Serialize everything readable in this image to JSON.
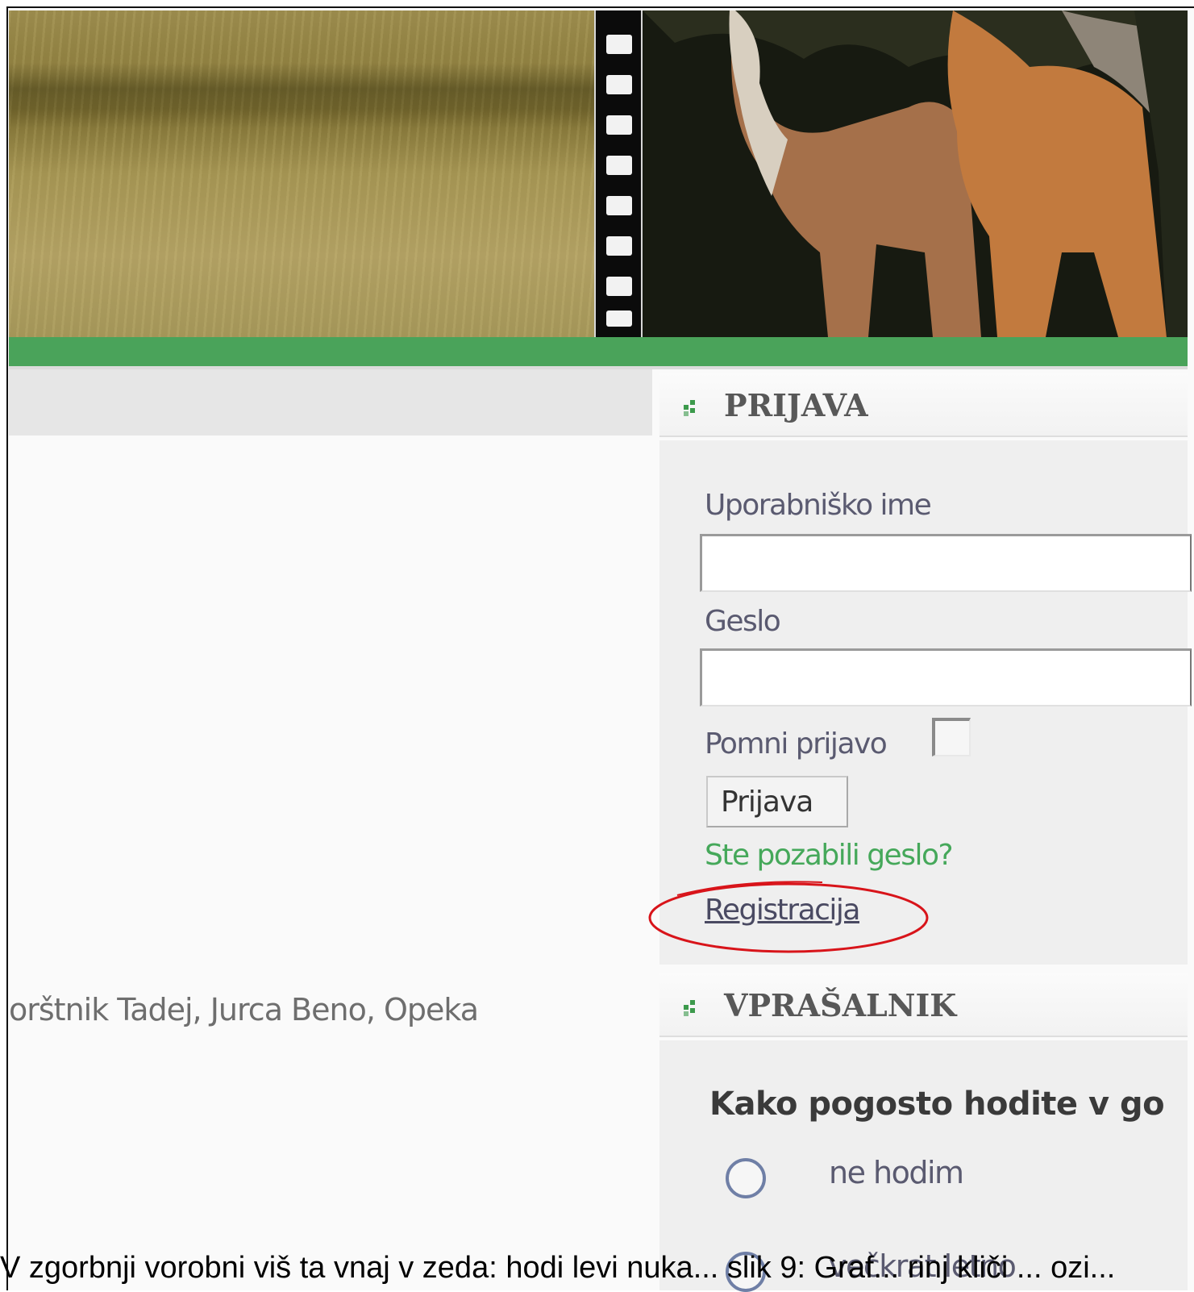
{
  "left": {
    "authors_text": "orštnik Tadej, Jurca Beno, Opeka"
  },
  "login": {
    "title": "PRIJAVA",
    "username_label": "Uporabniško ime",
    "username_value": "",
    "password_label": "Geslo",
    "password_value": "",
    "remember_label": "Pomni prijavo",
    "remember_checked": false,
    "submit_label": "Prijava",
    "forgot_link": "Ste pozabili geslo?",
    "register_link": "Registracija"
  },
  "poll": {
    "title": "VPRAŠALNIK",
    "question": "Kako pogosto hodite v go",
    "options": [
      "ne hodim",
      "večkrat letno"
    ]
  },
  "caption": "V zgorbnji vorobni viš ta vnaj v zeda: hodi levi nuka... slik 9: Graf... rinj kliči ... ozi...",
  "colors": {
    "accent_green": "#4aa35a",
    "annotation_red": "#d8141a"
  },
  "icons": {
    "panel_bullet": "green-dots-icon"
  }
}
